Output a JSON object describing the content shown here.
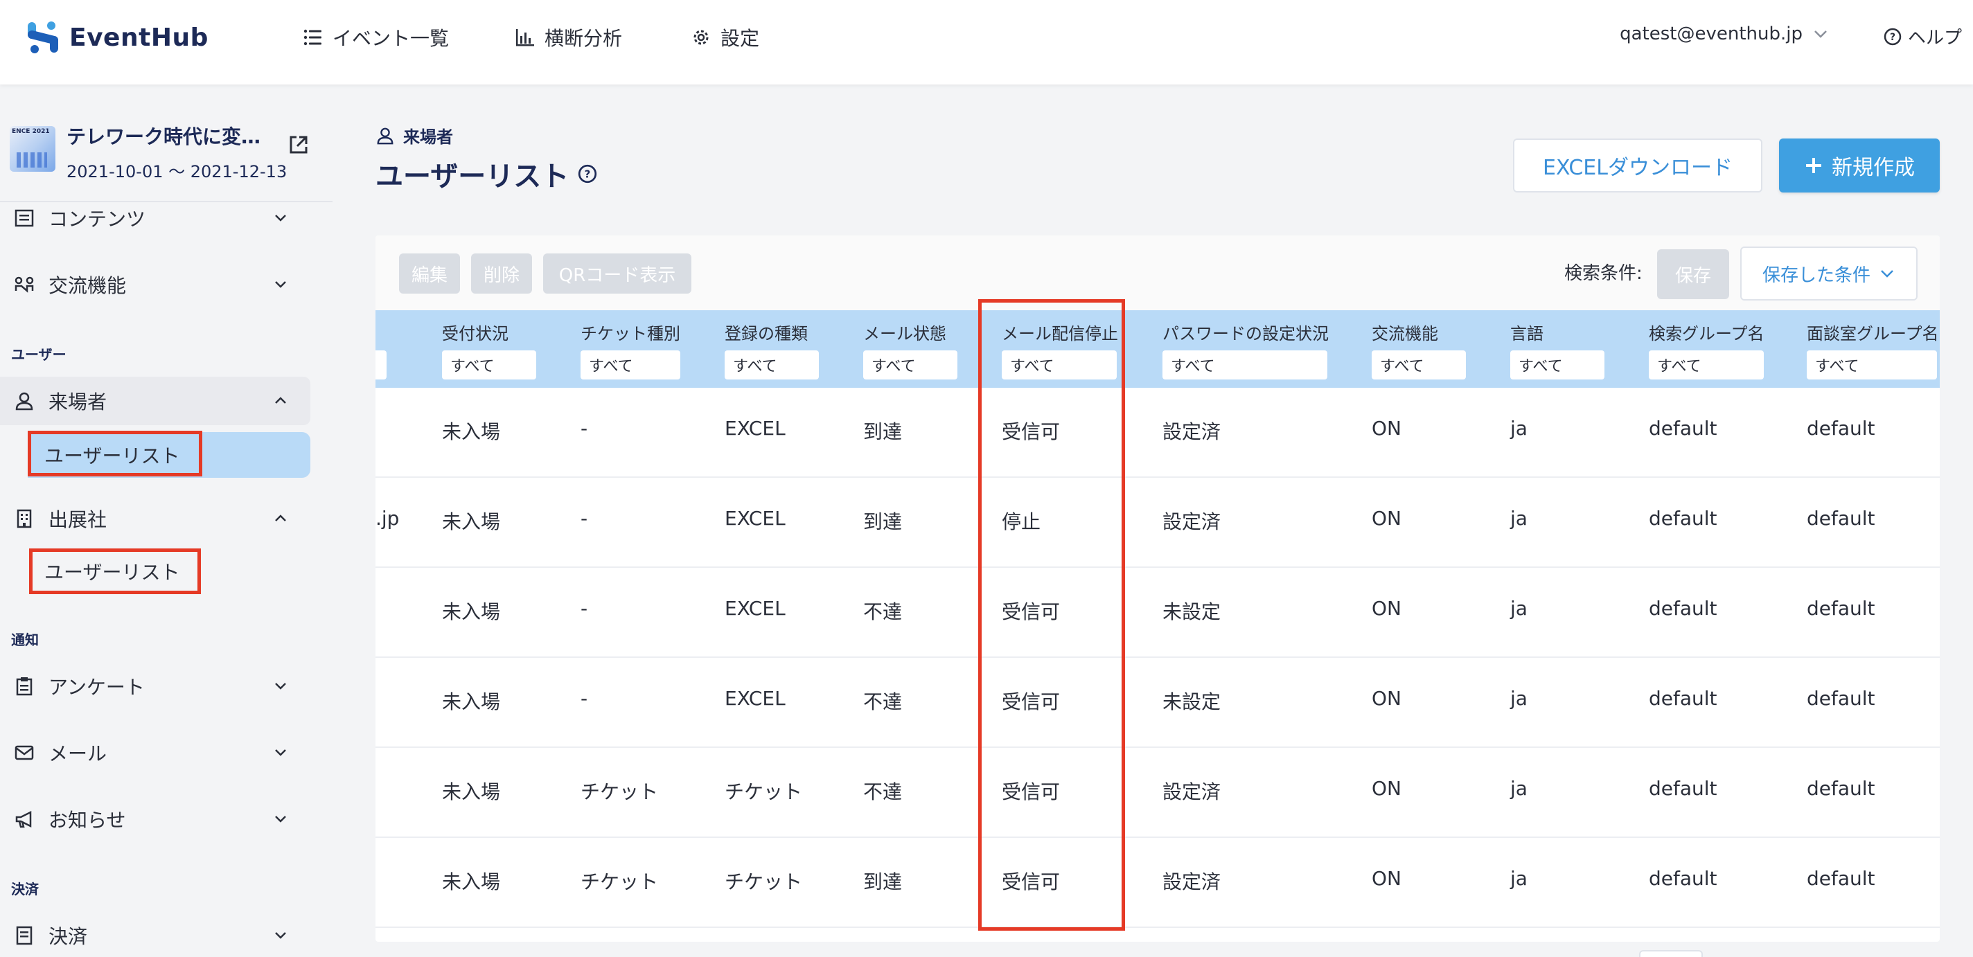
{
  "app": {
    "name": "EventHub"
  },
  "header": {
    "nav": [
      {
        "label": "イベント一覧",
        "icon": "list-icon"
      },
      {
        "label": "横断分析",
        "icon": "bar-chart-icon"
      },
      {
        "label": "設定",
        "icon": "gear-icon"
      }
    ],
    "account": "qatest@eventhub.jp",
    "help": "ヘルプ"
  },
  "event": {
    "thumb_text": "ENCE 2021",
    "title": "テレワーク時代に変…",
    "dates": "2021-10-01 ～ 2021-12-13"
  },
  "sidebar": {
    "contents": "コンテンツ",
    "networking": "交流機能",
    "section_user": "ユーザー",
    "visitors": "来場者",
    "visitors_user_list": "ユーザーリスト",
    "exhibitors": "出展社",
    "exhibitors_user_list": "ユーザーリスト",
    "section_notice": "通知",
    "survey": "アンケート",
    "mail": "メール",
    "news": "お知らせ",
    "section_payment": "決済",
    "payment": "決済"
  },
  "main": {
    "breadcrumb": "来場者",
    "title": "ユーザーリスト",
    "excel_button": "EXCELダウンロード",
    "new_button": "新規作成"
  },
  "toolbar": {
    "edit": "編集",
    "delete": "削除",
    "qr": "QRコード表示",
    "search_label": "検索条件:",
    "save": "保存",
    "saved_conditions": "保存した条件"
  },
  "table": {
    "columns": [
      "受付状況",
      "チケット種別",
      "登録の種類",
      "メール状態",
      "メール配信停止",
      "パスワードの設定状況",
      "交流機能",
      "言語",
      "検索グループ名",
      "面談室グループ名"
    ],
    "filter_value": "すべて",
    "rows": [
      {
        "partial": "",
        "cells": [
          "未入場",
          "-",
          "EXCEL",
          "到達",
          "受信可",
          "設定済",
          "ON",
          "ja",
          "default",
          "default"
        ]
      },
      {
        "partial": ".jp",
        "cells": [
          "未入場",
          "-",
          "EXCEL",
          "到達",
          "停止",
          "設定済",
          "ON",
          "ja",
          "default",
          "default"
        ]
      },
      {
        "partial": "",
        "cells": [
          "未入場",
          "-",
          "EXCEL",
          "不達",
          "受信可",
          "未設定",
          "ON",
          "ja",
          "default",
          "default"
        ]
      },
      {
        "partial": "",
        "cells": [
          "未入場",
          "-",
          "EXCEL",
          "不達",
          "受信可",
          "未設定",
          "ON",
          "ja",
          "default",
          "default"
        ]
      },
      {
        "partial": "",
        "cells": [
          "未入場",
          "チケット",
          "チケット",
          "不達",
          "受信可",
          "設定済",
          "ON",
          "ja",
          "default",
          "default"
        ]
      },
      {
        "partial": "",
        "cells": [
          "未入場",
          "チケット",
          "チケット",
          "到達",
          "受信可",
          "設定済",
          "ON",
          "ja",
          "default",
          "default"
        ]
      }
    ]
  },
  "colors": {
    "accent": "#3fa0e1",
    "highlight": "#e53a26",
    "header_bg": "#b9daf7",
    "brand": "#1d2a57"
  }
}
